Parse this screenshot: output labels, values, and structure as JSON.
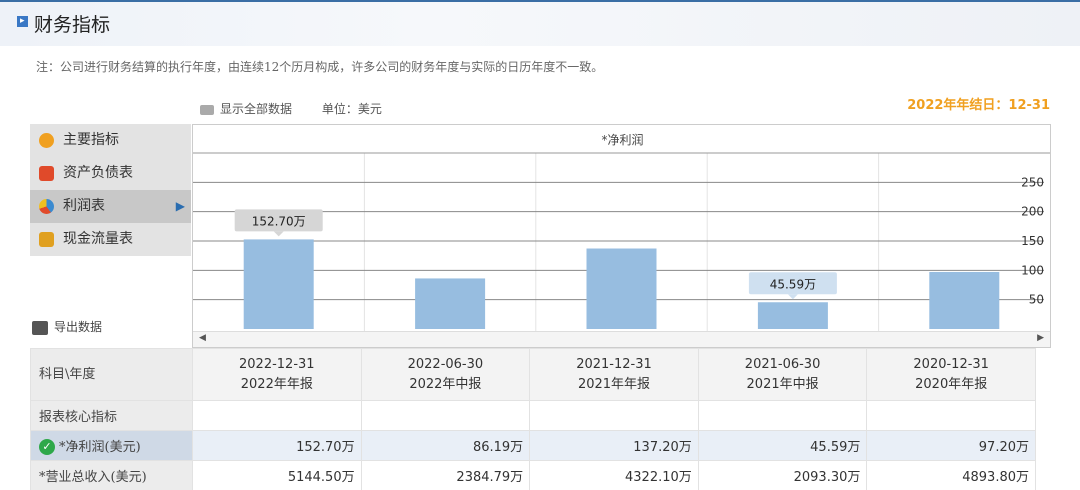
{
  "header": {
    "title": "财务指标",
    "marker_glyph": "▸"
  },
  "note": "注：公司进行财务结算的执行年度，由连续12个历月构成，许多公司的财务年度与实际的日历年度不一致。",
  "toolbar": {
    "show_all": "显示全部数据",
    "unit": "单位：美元"
  },
  "year_end": "2022年年结日：12-31",
  "sidebar": {
    "items": [
      {
        "label": "主要指标",
        "icon": "gear-icon",
        "color": "#f0a020"
      },
      {
        "label": "资产负债表",
        "icon": "document-icon",
        "color": "#e04a2a"
      },
      {
        "label": "利润表",
        "icon": "pie-icon",
        "color": "#3a8ad0",
        "active": true
      },
      {
        "label": "现金流量表",
        "icon": "coins-icon",
        "color": "#e0a020"
      }
    ],
    "active_arrow": "▶",
    "export_label": "导出数据"
  },
  "chart_data": {
    "type": "bar",
    "title": "*净利润",
    "categories": [
      "2022-12-31",
      "2022-06-30",
      "2021-12-31",
      "2021-06-30",
      "2020-12-31"
    ],
    "values": [
      152.7,
      86.19,
      137.2,
      45.59,
      97.2
    ],
    "unit": "万",
    "y_ticks": [
      50,
      100,
      150,
      200,
      250
    ],
    "ylim": [
      0,
      300
    ],
    "bar_color": "#97bde0",
    "data_labels": [
      {
        "index": 0,
        "text": "152.70万"
      },
      {
        "index": 3,
        "text": "45.59万"
      }
    ],
    "scroll_left": "◀",
    "scroll_right": "▶"
  },
  "table": {
    "corner": "科目\\年度",
    "columns": [
      {
        "date": "2022-12-31",
        "report": "2022年年报"
      },
      {
        "date": "2022-06-30",
        "report": "2022年中报"
      },
      {
        "date": "2021-12-31",
        "report": "2021年年报"
      },
      {
        "date": "2021-06-30",
        "report": "2021年中报"
      },
      {
        "date": "2020-12-31",
        "report": "2020年年报"
      }
    ],
    "rows": [
      {
        "label": "报表核心指标",
        "values": [
          "",
          "",
          "",
          "",
          ""
        ]
      },
      {
        "label": "*净利润(美元)",
        "values": [
          "152.70万",
          "86.19万",
          "137.20万",
          "45.59万",
          "97.20万"
        ],
        "highlight": true,
        "check": "✓"
      },
      {
        "label": "*营业总收入(美元)",
        "values": [
          "5144.50万",
          "2384.79万",
          "4322.10万",
          "2093.30万",
          "4893.80万"
        ]
      }
    ]
  }
}
